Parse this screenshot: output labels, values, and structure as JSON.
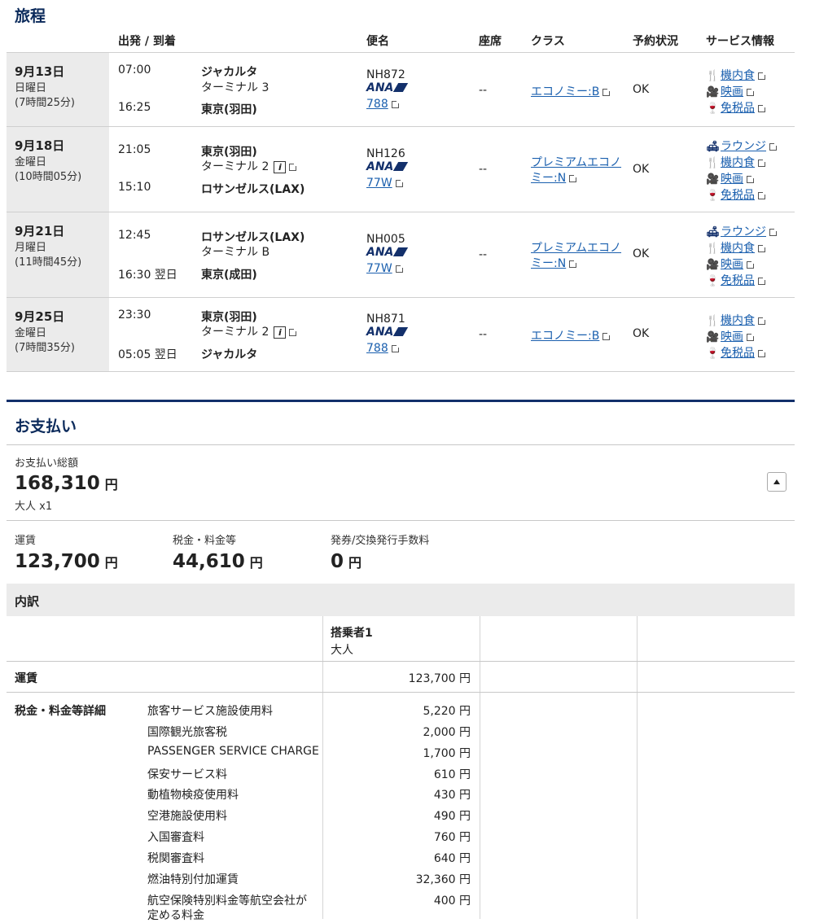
{
  "itinerary": {
    "title": "旅程",
    "headers": {
      "dep_arr": "出発 / 到着",
      "flight": "便名",
      "seat": "座席",
      "class": "クラス",
      "status": "予約状況",
      "services": "サービス情報"
    },
    "segments": [
      {
        "date": "9月13日",
        "weekday": "日曜日",
        "duration": "(7時間25分)",
        "dep_time": "07:00",
        "dep_city": "ジャカルタ",
        "dep_terminal": "ターミナル 3",
        "arr_time": "16:25",
        "arr_city": "東京(羽田)",
        "flight_no": "NH872",
        "airline": "ANA",
        "aircraft": "788",
        "seat": "--",
        "class": "エコノミー:B",
        "status": "OK",
        "services": [
          "機内食",
          "映画",
          "免税品"
        ]
      },
      {
        "date": "9月18日",
        "weekday": "金曜日",
        "duration": "(10時間05分)",
        "dep_time": "21:05",
        "dep_city": "東京(羽田)",
        "dep_terminal": "ターミナル 2",
        "arr_time": "15:10",
        "arr_city": "ロサンゼルス(LAX)",
        "flight_no": "NH126",
        "airline": "ANA",
        "aircraft": "77W",
        "seat": "--",
        "class_l1": "プレミアムエコノ",
        "class_l2": "ミー:N",
        "status": "OK",
        "services": [
          "ラウンジ",
          "機内食",
          "映画",
          "免税品"
        ]
      },
      {
        "date": "9月21日",
        "weekday": "月曜日",
        "duration": "(11時間45分)",
        "dep_time": "12:45",
        "dep_city": "ロサンゼルス(LAX)",
        "dep_terminal": "ターミナル B",
        "arr_time": "16:30 翌日",
        "arr_city": "東京(成田)",
        "flight_no": "NH005",
        "airline": "ANA",
        "aircraft": "77W",
        "seat": "--",
        "class_l1": "プレミアムエコノ",
        "class_l2": "ミー:N",
        "status": "OK",
        "services": [
          "ラウンジ",
          "機内食",
          "映画",
          "免税品"
        ]
      },
      {
        "date": "9月25日",
        "weekday": "金曜日",
        "duration": "(7時間35分)",
        "dep_time": "23:30",
        "dep_city": "東京(羽田)",
        "dep_terminal": "ターミナル 2",
        "arr_time": "05:05 翌日",
        "arr_city": "ジャカルタ",
        "flight_no": "NH871",
        "airline": "ANA",
        "aircraft": "788",
        "seat": "--",
        "class": "エコノミー:B",
        "status": "OK",
        "services": [
          "機内食",
          "映画",
          "免税品"
        ]
      }
    ]
  },
  "payment": {
    "title": "お支払い",
    "total_label": "お支払い総額",
    "total_amount": "168,310",
    "yen": "円",
    "passenger_count": "大人 x1",
    "fare_label": "運賃",
    "fare_amount": "123,700",
    "tax_label": "税金・料金等",
    "tax_amount": "44,610",
    "fee_label": "発券/交換発行手数料",
    "fee_amount": "0"
  },
  "breakdown": {
    "title": "内訳",
    "passenger_header": "搭乗者1",
    "passenger_type": "大人",
    "fare_label": "運賃",
    "fare_value": "123,700 円",
    "tax_label": "税金・料金等詳細",
    "tax_items": [
      {
        "name": "旅客サービス施設使用料",
        "value": "5,220 円"
      },
      {
        "name": "国際観光旅客税",
        "value": "2,000 円"
      },
      {
        "name": "PASSENGER SERVICE CHARGE",
        "value": "1,700 円"
      },
      {
        "name": "保安サービス料",
        "value": "610 円"
      },
      {
        "name": "動植物検疫使用料",
        "value": "430 円"
      },
      {
        "name": "空港施設使用料",
        "value": "490 円"
      },
      {
        "name": "入国審査料",
        "value": "760 円"
      },
      {
        "name": "税関審査料",
        "value": "640 円"
      },
      {
        "name": "燃油特別付加運賃",
        "value": "32,360 円"
      },
      {
        "name_l1": "航空保険特別料金等航空会社が",
        "name_l2": "定める料金",
        "value": "400 円"
      }
    ]
  }
}
